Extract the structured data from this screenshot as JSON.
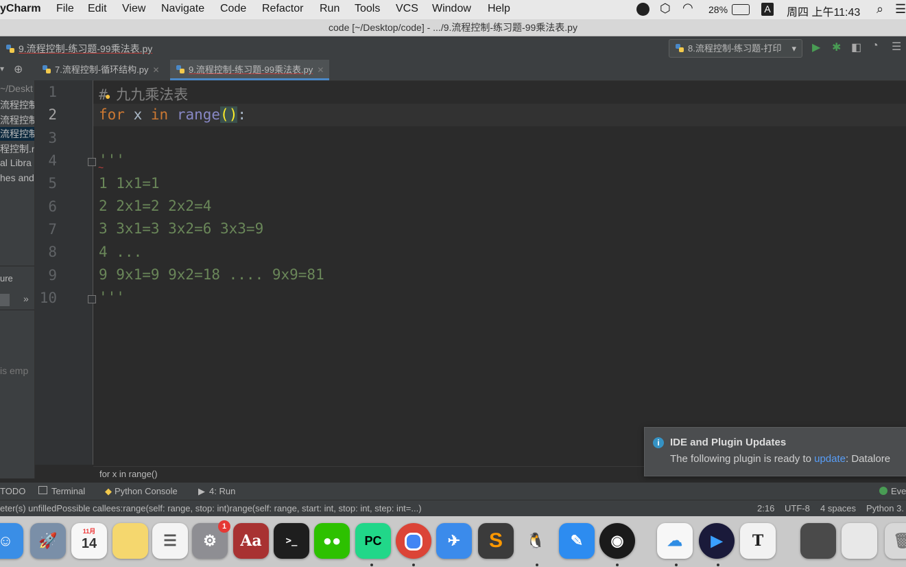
{
  "menubar": {
    "app": "yCharm",
    "items": [
      "File",
      "Edit",
      "View",
      "Navigate",
      "Code",
      "Refactor",
      "Run",
      "Tools",
      "VCS",
      "Window",
      "Help"
    ],
    "battery": "28%",
    "input_method": "A",
    "clock": "周四 上午11:43"
  },
  "window": {
    "title": "code [~/Desktop/code] - .../9.流程控制-练习题-99乘法表.py"
  },
  "navbar": {
    "file": "9.流程控制-练习题-99乘法表.py",
    "run_config": "8.流程控制-练习题-打印"
  },
  "tabs": [
    {
      "label": "7.流程控制-循环结构.py",
      "active": false
    },
    {
      "label": "9.流程控制-练习题-99乘法表.py",
      "active": true
    }
  ],
  "project_tree": {
    "items": [
      "~/Deskt",
      "流程控制-",
      "流程控制-",
      "流程控制-",
      "程控制.m",
      "al Libra",
      "hes and"
    ],
    "structure_label": "ure",
    "empty_text": "is emp"
  },
  "editor": {
    "line_numbers": [
      "1",
      "2",
      "3",
      "4",
      "5",
      "6",
      "7",
      "8",
      "9",
      "10"
    ],
    "current_line": "2",
    "comment_hash": "#",
    "comment_text": " 九九乘法表",
    "kw_for": "for",
    "var_x": " x ",
    "kw_in": "in",
    "fn_range": "range",
    "parens": "()",
    "colon": ":",
    "quote_open": "'''",
    "doc_lines": [
      "1 1x1=1",
      "2 2x1=2 2x2=4",
      "3 3x1=3 3x2=6 3x3=9",
      "4 ...",
      "9 9x1=9 9x2=18 .... 9x9=81"
    ],
    "quote_close": "'''",
    "breadcrumb": "for x in range()"
  },
  "notification": {
    "title": "IDE and Plugin Updates",
    "body_prefix": "The following plugin is ready to ",
    "link": "update",
    "body_suffix": ": Datalore"
  },
  "toolwindows": {
    "todo": "TODO",
    "terminal": "Terminal",
    "python_console": "Python Console",
    "run": "4: Run",
    "event_log": "Eve"
  },
  "statusbar": {
    "message": "eter(s) unfilledPossible callees:range(self: range, stop: int)range(self: range, start: int, stop: int, step: int=...)",
    "position": "2:16",
    "encoding": "UTF-8",
    "indent": "4 spaces",
    "interpreter": "Python 3."
  },
  "dock": {
    "calendar_day": "14",
    "calendar_month": "11月",
    "badge": "1",
    "terminal_glyph": ">_",
    "pycharm_glyph": "PC",
    "dictionary_glyph": "Aa",
    "typora_glyph": "T"
  }
}
